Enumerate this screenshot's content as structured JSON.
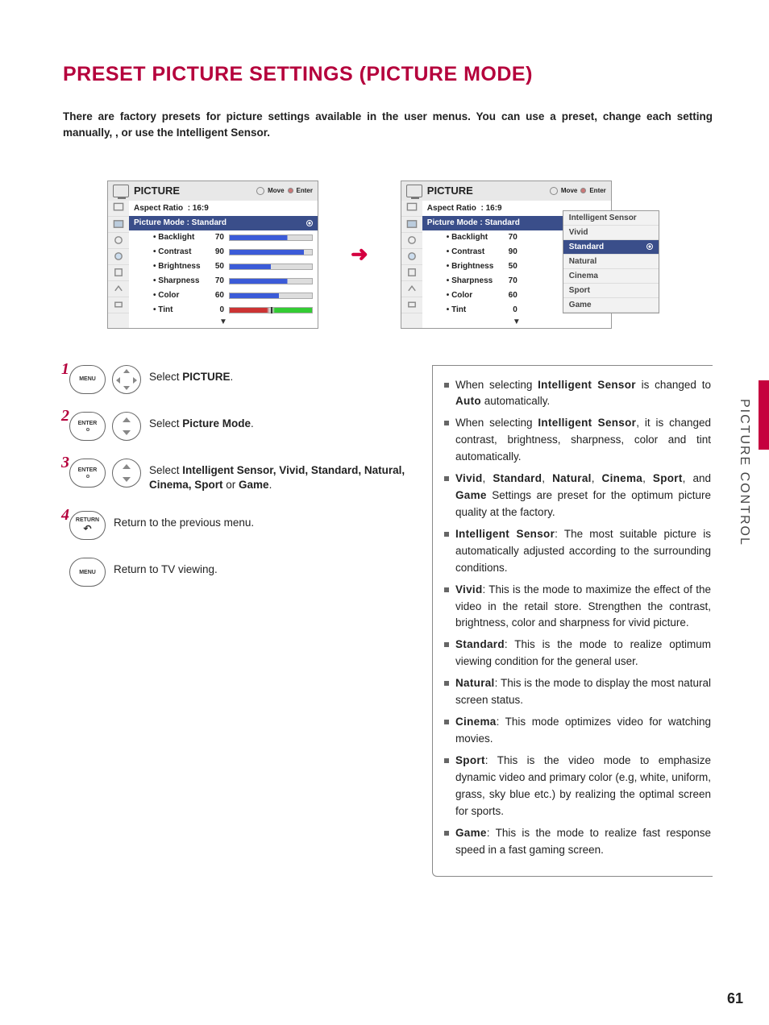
{
  "title": "PRESET PICTURE SETTINGS (PICTURE MODE)",
  "intro": "There are factory presets for picture settings available in the user menus. You can use a preset, change each setting manually, , or use the Intelligent Sensor.",
  "side_label": "PICTURE CONTROL",
  "page_number": "61",
  "osd": {
    "title": "PICTURE",
    "hints_move": "Move",
    "hints_enter": "Enter",
    "aspect_label": "Aspect Ratio",
    "aspect_value": ": 16:9",
    "mode_label": "Picture Mode",
    "mode_value": ": Standard",
    "rows": [
      {
        "label": "• Backlight",
        "value": "70",
        "pct": "70%"
      },
      {
        "label": "• Contrast",
        "value": "90",
        "pct": "90%"
      },
      {
        "label": "• Brightness",
        "value": "50",
        "pct": "50%"
      },
      {
        "label": "• Sharpness",
        "value": "70",
        "pct": "70%"
      },
      {
        "label": "• Color",
        "value": "60",
        "pct": "60%"
      },
      {
        "label": "• Tint",
        "value": "0",
        "pct": "tint"
      }
    ],
    "dropdown": [
      "Intelligent Sensor",
      "Vivid",
      "Standard",
      "Natural",
      "Cinema",
      "Sport",
      "Game"
    ],
    "dropdown_selected": "Standard"
  },
  "steps": {
    "s1_num": "1",
    "s1_btn": "MENU",
    "s1_pre": "Select ",
    "s1_bold": "PICTURE",
    "s1_post": ".",
    "s2_num": "2",
    "s2_btn": "ENTER",
    "s2_pre": "Select ",
    "s2_bold": "Picture Mode",
    "s2_post": ".",
    "s3_num": "3",
    "s3_btn": "ENTER",
    "s3_pre": "Select ",
    "s3_bold": "Intelligent Sensor, Vivid, Standard, Natural, Cinema, Sport",
    "s3_mid": " or ",
    "s3_bold2": "Game",
    "s3_post": ".",
    "s4_num": "4",
    "s4_btn": "RETURN",
    "s4_text": "Return to the previous menu.",
    "s5_btn": "MENU",
    "s5_text": "Return to TV viewing."
  },
  "info": {
    "i1a": "When selecting ",
    "i1b": "Intelligent Sensor",
    "i1c": " is changed to ",
    "i1d": "Auto",
    "i1e": " automatically.",
    "i2a": "When selecting ",
    "i2b": "Intelligent Sensor",
    "i2c": ", it is changed contrast, brightness, sharpness, color and tint automatically.",
    "i3a": "Vivid",
    "i3b": ", ",
    "i3c": "Standard",
    "i3d": ", ",
    "i3e": "Natural",
    "i3f": ", ",
    "i3g": "Cinema",
    "i3h": ", ",
    "i3i": "Sport",
    "i3j": ", and ",
    "i3k": "Game",
    "i3l": " Settings are preset for the optimum picture quality at the factory.",
    "i4a": "Intelligent Sensor",
    "i4b": ": The most suitable picture is automatically adjusted according to the surrounding conditions.",
    "i5a": "Vivid",
    "i5b": ": This is the mode to maximize the effect of the video in the retail store. Strengthen the contrast, brightness, color and sharpness for vivid picture.",
    "i6a": "Standard",
    "i6b": ": This is the mode to realize optimum viewing condition for the general user.",
    "i7a": "Natural",
    "i7b": ": This is the mode to display the most natural screen status.",
    "i8a": "Cinema",
    "i8b": ": This mode optimizes video for watching movies.",
    "i9a": "Sport",
    "i9b": ": This is the video mode to emphasize dynamic video and primary color (e.g, white, uniform, grass, sky blue etc.) by realizing the optimal screen for sports.",
    "i10a": "Game",
    "i10b": ": This is the mode to realize fast response speed in a fast gaming screen."
  }
}
